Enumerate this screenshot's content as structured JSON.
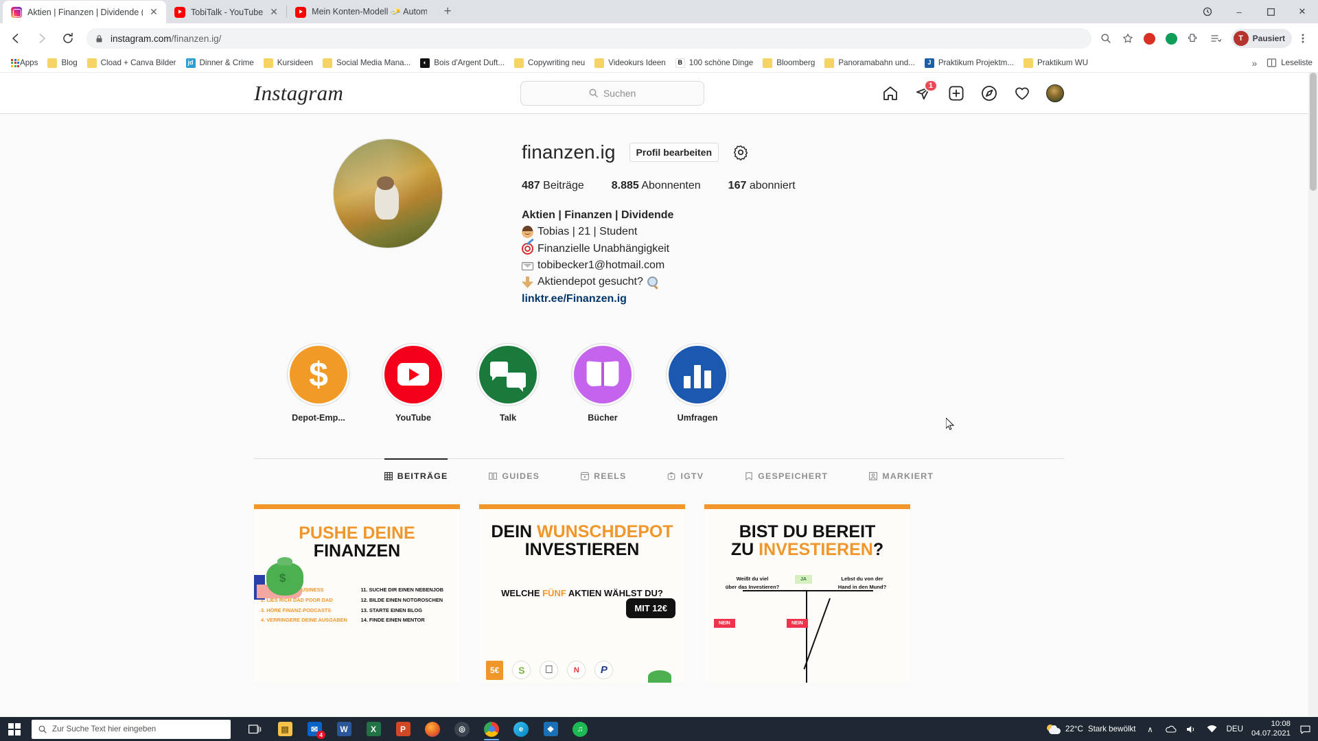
{
  "browser": {
    "tabs": [
      {
        "title": "Aktien | Finanzen | Dividende (@",
        "favicon": "instagram-icon",
        "active": true
      },
      {
        "title": "TobiTalk - YouTube",
        "favicon": "youtube-icon",
        "active": false
      },
      {
        "title": "Mein Konten-Modell 🧈 Automa",
        "favicon": "youtube-icon",
        "active": false
      }
    ],
    "new_tab_label": "+",
    "window_controls": {
      "minimize": "–",
      "maximize": "□",
      "close": "✕"
    },
    "url": {
      "scheme_icon": "lock-icon",
      "domain": "instagram.com",
      "path": "/finanzen.ig/"
    },
    "omnibox_icons": [
      "zoom-icon",
      "bookmark-star-icon"
    ],
    "extensions": [
      "extension-red-icon",
      "extension-green-icon",
      "extension-puzzle-icon",
      "extension-list-icon"
    ],
    "profile": {
      "initial": "T",
      "label": "Pausiert"
    },
    "menu_icon": "kebab-menu-icon",
    "bookmarks": [
      {
        "label": "Apps",
        "icon": "apps-grid-icon"
      },
      {
        "label": "Blog",
        "icon": "folder-icon"
      },
      {
        "label": "Cload + Canva Bilder",
        "icon": "folder-icon"
      },
      {
        "label": "Dinner & Crime",
        "icon": "jd-icon",
        "color": "#2a9fd6",
        "glyph": "jd"
      },
      {
        "label": "Kursideen",
        "icon": "folder-icon"
      },
      {
        "label": "Social Media Mana...",
        "icon": "folder-icon"
      },
      {
        "label": "Bois d'Argent Duft...",
        "icon": "site-icon",
        "color": "#111111",
        "glyph": "ⓘ"
      },
      {
        "label": "Copywriting neu",
        "icon": "folder-icon"
      },
      {
        "label": "Videokurs Ideen",
        "icon": "folder-icon"
      },
      {
        "label": "100 schöne Dinge",
        "icon": "site-icon",
        "color": "#ffffff",
        "glyph": "B"
      },
      {
        "label": "Bloomberg",
        "icon": "folder-icon"
      },
      {
        "label": "Panoramabahn und...",
        "icon": "folder-icon"
      },
      {
        "label": "Praktikum Projektm...",
        "icon": "jira-icon",
        "color": "#1a5fa8",
        "glyph": "J"
      },
      {
        "label": "Praktikum WU",
        "icon": "folder-icon"
      }
    ],
    "bookmarks_overflow": "»",
    "reading_list": {
      "label": "Leseliste",
      "icon": "reading-list-icon"
    }
  },
  "instagram": {
    "logo": "Instagram",
    "search_placeholder": "Suchen",
    "nav": [
      {
        "name": "home-icon"
      },
      {
        "name": "direct-messages-icon",
        "badge": "1"
      },
      {
        "name": "new-post-icon"
      },
      {
        "name": "explore-icon"
      },
      {
        "name": "activity-heart-icon"
      },
      {
        "name": "profile-avatar"
      }
    ],
    "profile": {
      "username": "finanzen.ig",
      "edit_button": "Profil bearbeiten",
      "settings_icon": "gear-icon",
      "stats": [
        {
          "value": "487",
          "label": "Beiträge"
        },
        {
          "value": "8.885",
          "label": "Abonnenten"
        },
        {
          "value": "167",
          "label": "abonniert"
        }
      ],
      "bio": {
        "display_name": "Aktien | Finanzen | Dividende",
        "lines": [
          {
            "emoji": "man-face-emoji",
            "text": "Tobias | 21 | Student"
          },
          {
            "emoji": "dart-target-emoji",
            "text": "Finanzielle Unabhängigkeit"
          },
          {
            "emoji": "envelope-emoji",
            "text": "tobibecker1@hotmail.com"
          },
          {
            "emoji": "backhand-down-emoji",
            "text": "Aktiendepot gesucht?",
            "emoji_end": "magnifier-emoji"
          }
        ],
        "link": "linktr.ee/Finanzen.ig"
      },
      "highlights": [
        {
          "label": "Depot-Emp...",
          "color": "#f29a26",
          "icon": "dollar-sign-icon"
        },
        {
          "label": "YouTube",
          "color": "#f4001b",
          "icon": "youtube-play-icon"
        },
        {
          "label": "Talk",
          "color": "#1a7a3c",
          "icon": "speech-bubbles-icon"
        },
        {
          "label": "Bücher",
          "color": "#c463ec",
          "icon": "open-book-icon"
        },
        {
          "label": "Umfragen",
          "color": "#1b59b0",
          "icon": "bar-chart-icon"
        }
      ],
      "tabs": [
        {
          "label": "BEITRÄGE",
          "icon": "grid-icon",
          "active": true
        },
        {
          "label": "GUIDES",
          "icon": "guides-icon",
          "active": false
        },
        {
          "label": "REELS",
          "icon": "reels-icon",
          "active": false
        },
        {
          "label": "IGTV",
          "icon": "igtv-icon",
          "active": false
        },
        {
          "label": "GESPEICHERT",
          "icon": "bookmark-icon",
          "active": false
        },
        {
          "label": "MARKIERT",
          "icon": "tagged-person-icon",
          "active": false
        }
      ],
      "posts": [
        {
          "title_line1": "PUSHE DEINE",
          "title_line2": "FINANZEN",
          "list_left": "1. STARTE EIN BUSINESS\n2. LIES RICH DAD POOR DAD\n3. HÖRE FINANZ-PODCASTS\n4. VERRINGERE DEINE AUSGABEN",
          "list_right": "11. SUCHE DIR EINEN NEBENJOB\n12. BILDE EINEN NOTGROSCHEN\n13. STARTE EINEN BLOG\n14. FINDE EINEN MENTOR"
        },
        {
          "title_line1a": "DEIN ",
          "title_line1b": "WUNSCHDEPOT",
          "title_line2": "INVESTIEREN",
          "sub_a": "WELCHE ",
          "sub_b": "FÜNF",
          "sub_c": " AKTIEN WÄHLST DU?",
          "chip": "MIT 12€",
          "price_badge": "5€",
          "logos": [
            "shopify-icon",
            "apple-icon",
            "netflix-icon",
            "paypal-icon"
          ]
        },
        {
          "title_line1": "BIST DU BEREIT",
          "title_line2a": "ZU ",
          "title_line2b": "INVESTIEREN",
          "title_line2c": "?",
          "q_left": "Weißt du viel\nüber das Investieren?",
          "q_right": "Lebst du von der\nHand in den Mund?",
          "yes_badge": "JA",
          "no_badge_left": "NEIN",
          "no_badge_right": "NEIN"
        }
      ]
    }
  },
  "taskbar": {
    "search_placeholder": "Zur Suche Text hier eingeben",
    "search_icon": "search-icon",
    "start_icon": "windows-start-icon",
    "taskview_icon": "task-view-icon",
    "apps": [
      {
        "name": "file-explorer-icon",
        "color": "#f7c24a",
        "glyph": "📁"
      },
      {
        "name": "mail-icon",
        "color": "#0a64c8",
        "glyph": "✉",
        "badge": "4"
      },
      {
        "name": "word-icon",
        "color": "#2b579a",
        "glyph": "W"
      },
      {
        "name": "excel-icon",
        "color": "#217346",
        "glyph": "X"
      },
      {
        "name": "powerpoint-icon",
        "color": "#d24726",
        "glyph": "P"
      },
      {
        "name": "firefox-icon",
        "color": "#e66000",
        "glyph": "●"
      },
      {
        "name": "disc-icon",
        "color": "#4a4a4a",
        "glyph": "◎"
      },
      {
        "name": "chrome-icon",
        "color": "#4285f4",
        "glyph": "●",
        "running": true
      },
      {
        "name": "edge-icon",
        "color": "#0a84c1",
        "glyph": "e"
      },
      {
        "name": "photos-icon",
        "color": "#1b6fb5",
        "glyph": "❖"
      },
      {
        "name": "spotify-icon",
        "color": "#1db954",
        "glyph": "♫"
      }
    ],
    "tray": {
      "weather_temp": "22°C",
      "weather_desc": "Stark bewölkt",
      "chevron": "∧",
      "icons": [
        "onedrive-icon",
        "volume-icon",
        "network-icon"
      ],
      "language": "DEU",
      "time": "10:08",
      "date": "04.07.2021",
      "notification_icon": "notification-icon"
    }
  }
}
